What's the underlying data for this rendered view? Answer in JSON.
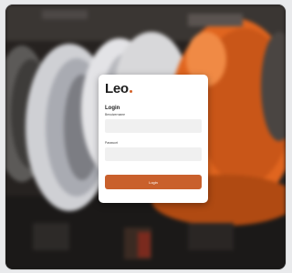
{
  "login_card": {
    "brand": "Leo",
    "heading": "Login",
    "username_label": "Benutzername",
    "username_value": "",
    "password_label": "Passwort",
    "password_value": "",
    "submit_label": "Login"
  },
  "colors": {
    "accent": "#c9602c",
    "field_bg": "#f0f0f0",
    "card_bg": "#ffffff"
  },
  "background": {
    "subject": "hard-hats-photo"
  }
}
